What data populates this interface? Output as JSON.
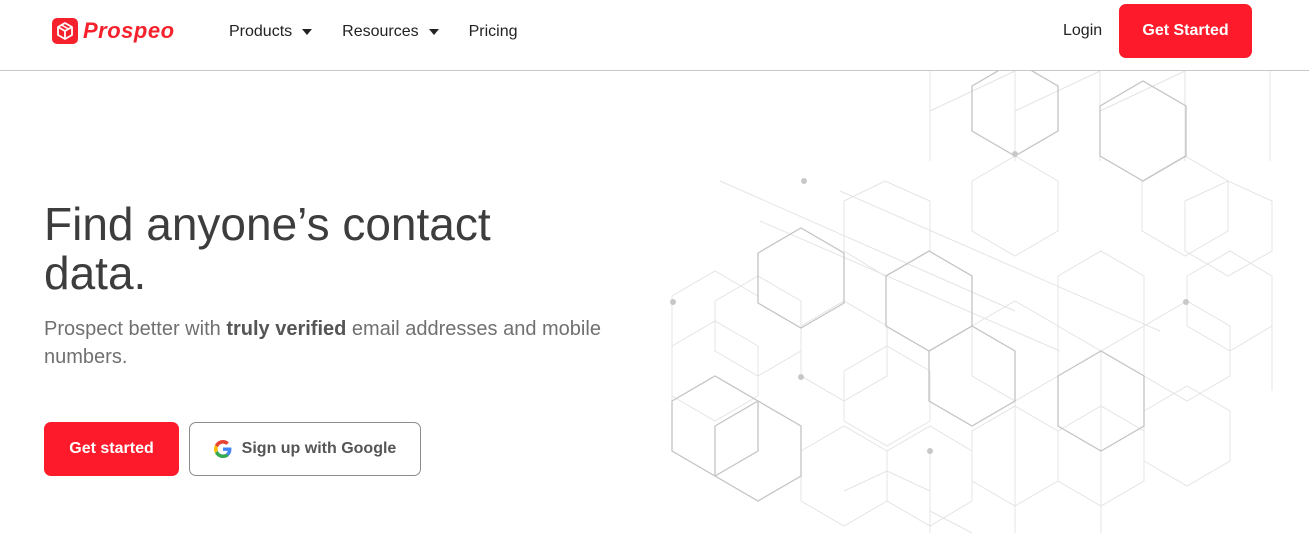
{
  "brand": {
    "name": "Prospeo",
    "color": "#fd1b2b"
  },
  "nav": {
    "items": [
      {
        "label": "Products",
        "has_dropdown": true
      },
      {
        "label": "Resources",
        "has_dropdown": true
      },
      {
        "label": "Pricing",
        "has_dropdown": false
      }
    ],
    "login_label": "Login",
    "cta_label": "Get Started"
  },
  "hero": {
    "title": "Find anyone’s contact data.",
    "subtitle_prefix": "Prospect better with ",
    "subtitle_bold": "truly verified",
    "subtitle_suffix": " email addresses and mobile numbers.",
    "primary_cta": "Get started",
    "google_cta": "Sign up with Google"
  },
  "icons": {
    "logo": "cube-logo-icon",
    "caret": "caret-down-icon",
    "google": "google-g-icon"
  }
}
